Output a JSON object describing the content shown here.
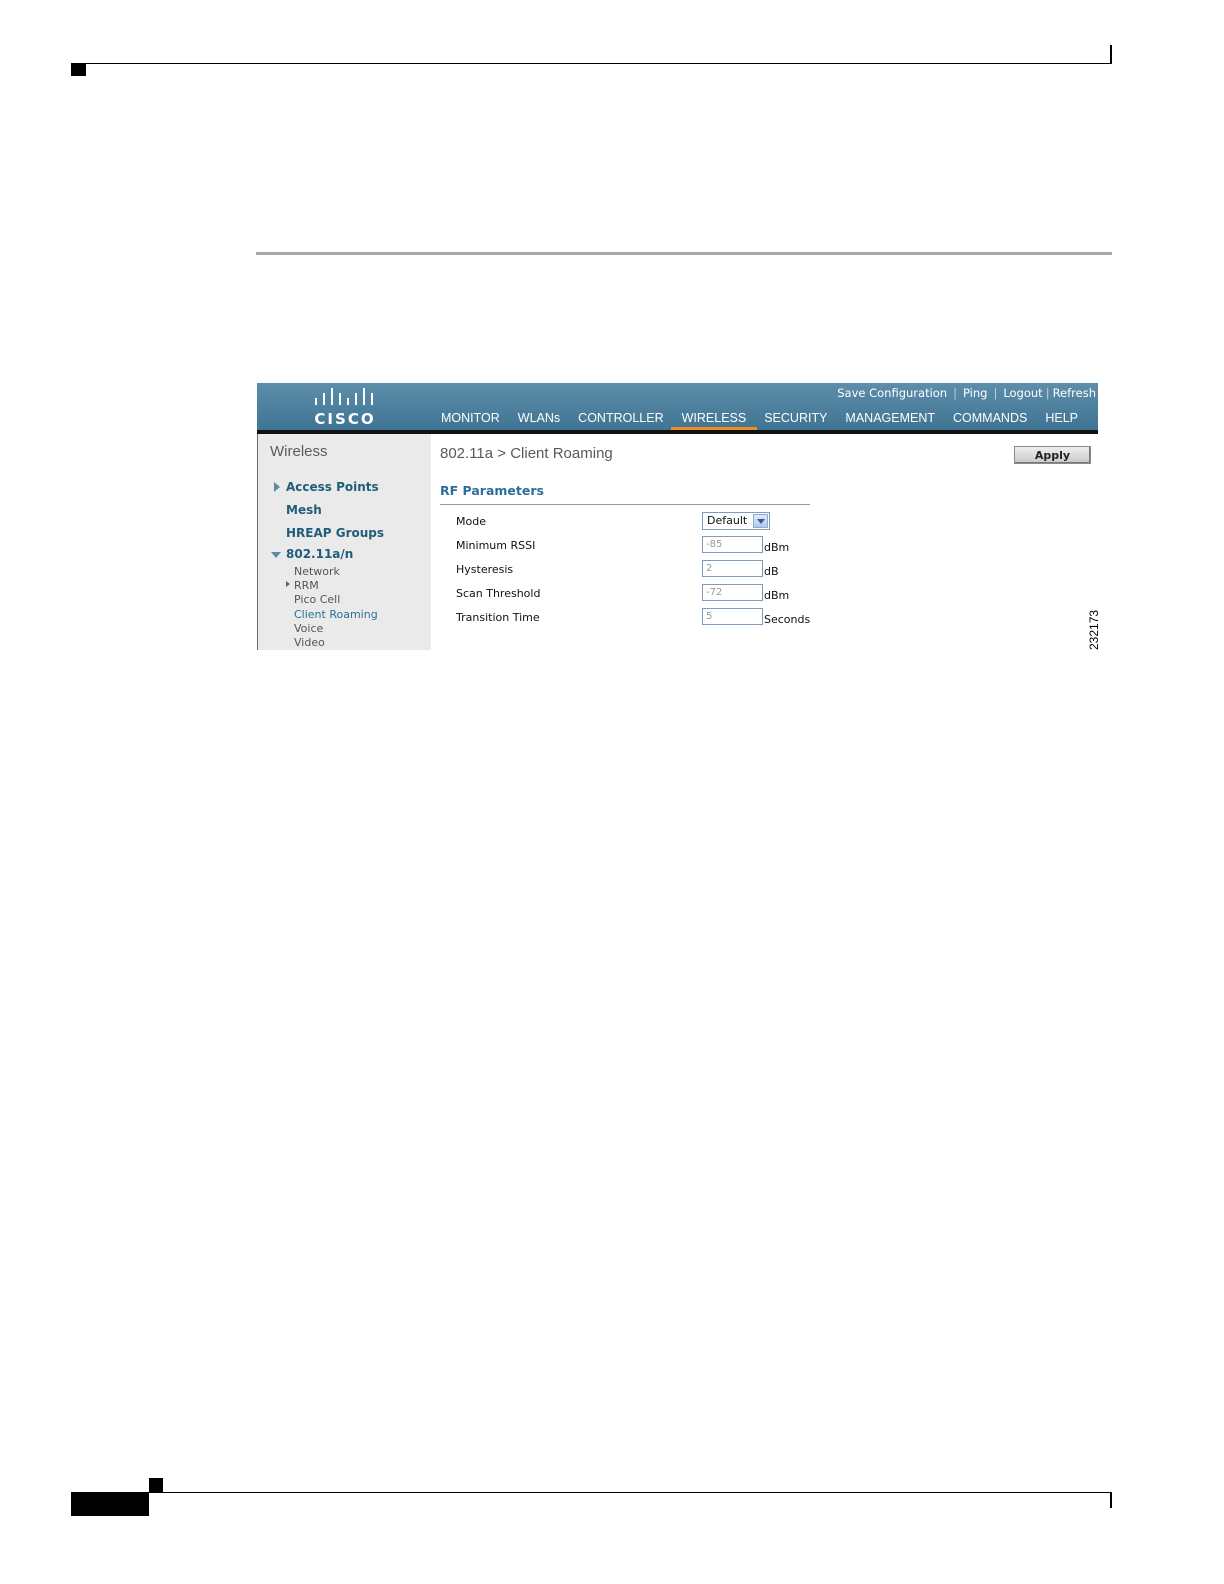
{
  "figure_id": "232173",
  "header": {
    "logo_text": "CISCO",
    "top_links": [
      "Save Configuration",
      "Ping",
      "Logout",
      "Refresh"
    ],
    "nav": [
      "MONITOR",
      "WLANs",
      "CONTROLLER",
      "WIRELESS",
      "SECURITY",
      "MANAGEMENT",
      "COMMANDS",
      "HELP"
    ],
    "active_nav": "WIRELESS"
  },
  "sidebar": {
    "title": "Wireless",
    "items": [
      "Access Points",
      "Mesh",
      "HREAP Groups",
      "802.11a/n"
    ],
    "sub_items": [
      "Network",
      "RRM",
      "Pico Cell",
      "Client Roaming",
      "Voice",
      "Video"
    ],
    "selected": "Client Roaming"
  },
  "content": {
    "breadcrumb": "802.11a > Client Roaming",
    "apply_label": "Apply",
    "section_title": "RF Parameters",
    "params": [
      {
        "label": "Mode",
        "value": "Default",
        "unit": ""
      },
      {
        "label": "Minimum RSSI",
        "value": "-85",
        "unit": "dBm"
      },
      {
        "label": "Hysteresis",
        "value": "2",
        "unit": "dB"
      },
      {
        "label": "Scan Threshold",
        "value": "-72",
        "unit": "dBm"
      },
      {
        "label": "Transition Time",
        "value": "5",
        "unit": "Seconds"
      }
    ]
  },
  "colors": {
    "header_blue": "#4a7f9e",
    "active_tab": "#f08c18",
    "link_blue": "#1f5d7a"
  }
}
